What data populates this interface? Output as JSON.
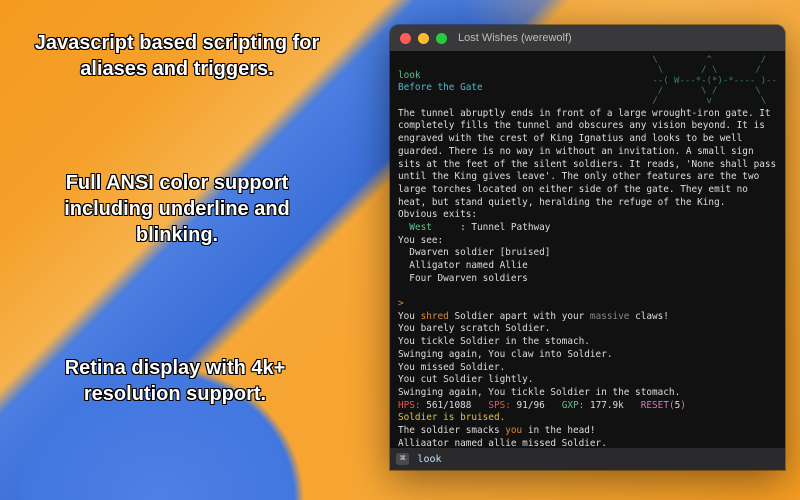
{
  "promo": {
    "p1": "Javascript based scripting for aliases and triggers.",
    "p2": "Full ANSI color support including underline and blinking.",
    "p3": "Retina display with 4k+ resolution support."
  },
  "window": {
    "title": "Lost Wishes (werewolf)"
  },
  "ascii": "\\         ^         /\n \\       / \\       /\n--( W---*-(*)-*---- )--\n /       \\ /       \\\n/         v         \\",
  "term": {
    "cmd_look": "look",
    "room_title": "Before the Gate",
    "desc": "The tunnel abruptly ends in front of a large wrought-iron gate. It completely fills the tunnel and obscures any vision beyond. It is engraved with the crest of King Ignatius and looks to be well guarded. There is no way in without an invitation. A small sign sits at the feet of the silent soldiers. It reads, 'None shall pass until the King gives leave'. The only other features are the two large torches located on either side of the gate. They emit no heat, but stand quietly, heralding the refuge of the King.",
    "exits_label": "Obvious exits:",
    "exit_dir": "  West",
    "exit_sep": "     : ",
    "exit_dest": "Tunnel Pathway",
    "you_see": "You see:",
    "see1": "  Dwarven soldier [bruised]",
    "see2": "  Alligator named Allie",
    "see3": "  Four Dwarven soldiers",
    "prompt": ">",
    "f1a": "You ",
    "f1b": "shred",
    "f1c": " Soldier apart with your ",
    "f1d": "massive",
    "f1e": " claws!",
    "f2": "You barely scratch Soldier.",
    "f3": "You tickle Soldier in the stomach.",
    "f4": "Swinging again, You claw into Soldier.",
    "f5": "You missed Soldier.",
    "f6": "You cut Soldier lightly.",
    "f7": "Swinging again, You tickle Soldier in the stomach.",
    "hp_lbl": "HPS: ",
    "hp_val": "561/1088",
    "sp_lbl": "   SPS: ",
    "sp_val": "91/96",
    "gxp_lbl": "   GXP: ",
    "gxp_val": "177.9k",
    "reset_lbl": "   RESET(",
    "reset_val": "5",
    "reset_close": ")",
    "bruised": "Soldier is bruised.",
    "smack_a": "The soldier smacks ",
    "smack_b": "you",
    "smack_c": " in the head!",
    "miss2": "Alliaator named allie missed Soldier."
  },
  "input": {
    "badge": "⌘",
    "value": "look"
  }
}
